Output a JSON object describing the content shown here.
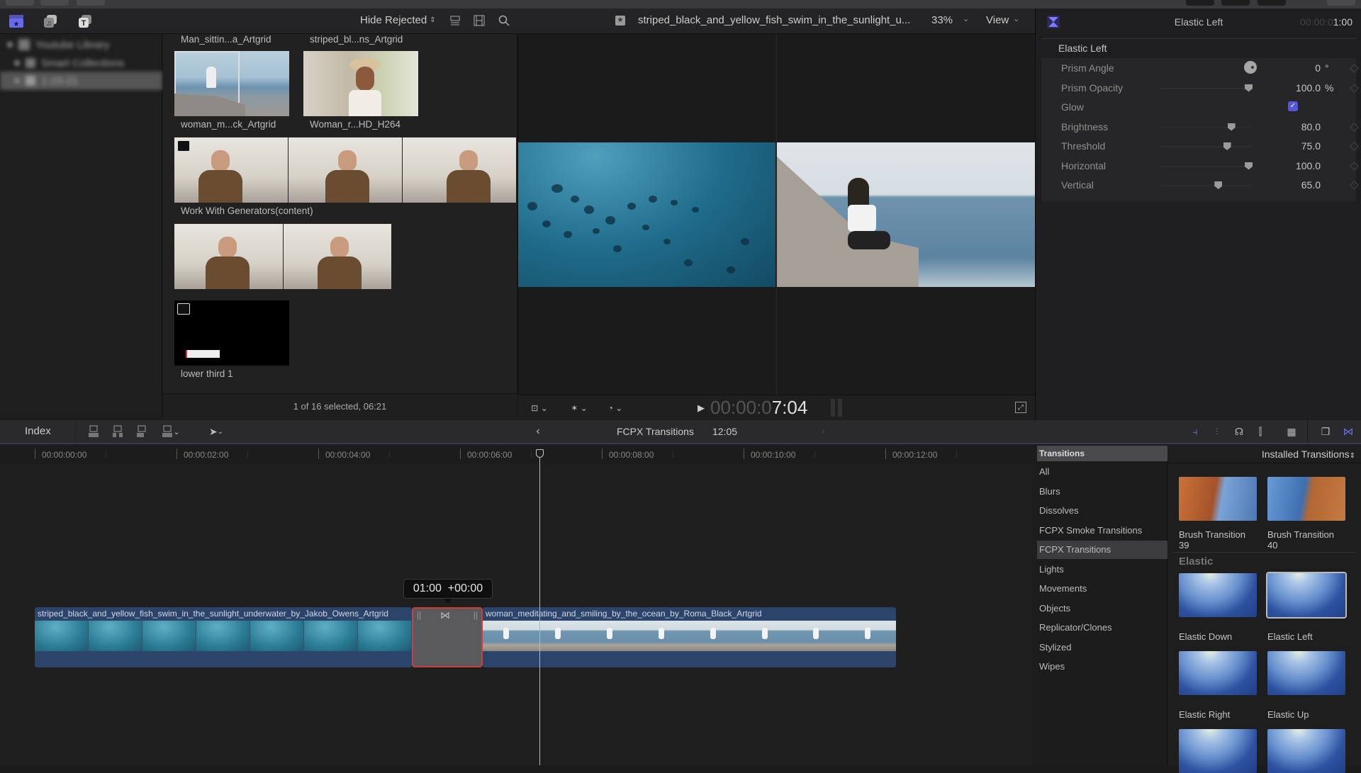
{
  "app": {
    "accent": "#5b5be0",
    "selection_outline": "#d0413a"
  },
  "library_sidebar": {
    "tabs": [
      {
        "icon": "libraries-icon",
        "active": true
      },
      {
        "icon": "photos-audio-icon",
        "active": false
      },
      {
        "icon": "titles-generators-icon",
        "active": false
      }
    ],
    "items": [
      {
        "label": "Youtube Library",
        "blurred": true
      },
      {
        "label": "Smart Collections",
        "blurred": true
      },
      {
        "label": "1-23-21",
        "blurred": true,
        "selected": true
      }
    ]
  },
  "browser": {
    "filter_label": "Hide Rejected",
    "icons": [
      "list-view-icon",
      "filmstrip-view-icon",
      "search-icon"
    ],
    "clips": [
      {
        "label": "Man_sittin...a_Artgrid"
      },
      {
        "label": "striped_bl...ns_Artgrid"
      },
      {
        "label": "woman_m...ck_Artgrid",
        "selected": true
      },
      {
        "label": "Woman_r...HD_H264"
      },
      {
        "label": "Work With Generators(content)"
      },
      {
        "label": ""
      },
      {
        "label": "lower third 1"
      }
    ],
    "status": "1 of 16 selected, 06:21"
  },
  "viewer": {
    "clip_name": "striped_black_and_yellow_fish_swim_in_the_sunlight_u...",
    "zoom": "33%",
    "view_label": "View",
    "timecode_dim": "00:00:0",
    "timecode_bright": "7:04"
  },
  "inspector": {
    "title": "Elastic Left",
    "duration_dim": "00:00:0",
    "duration_bright": "1:00",
    "section": "Elastic Left",
    "params": [
      {
        "label": "Prism Angle",
        "type": "dial",
        "value": "0",
        "unit": "°"
      },
      {
        "label": "Prism Opacity",
        "type": "slider",
        "value": "100.0",
        "unit": "%",
        "fraction": 1.0
      },
      {
        "label": "Glow",
        "type": "checkbox",
        "checked": true
      },
      {
        "label": "Brightness",
        "type": "slider",
        "value": "80.0",
        "unit": "",
        "fraction": 0.8
      },
      {
        "label": "Threshold",
        "type": "slider",
        "value": "75.0",
        "unit": "",
        "fraction": 0.75
      },
      {
        "label": "Horizontal",
        "type": "slider",
        "value": "100.0",
        "unit": "",
        "fraction": 1.0
      },
      {
        "label": "Vertical",
        "type": "slider",
        "value": "65.0",
        "unit": "",
        "fraction": 0.65
      }
    ]
  },
  "timeline": {
    "index_label": "Index",
    "project_name": "FCPX Transitions",
    "project_duration": "12:05",
    "ruler": [
      "00:00:00:00",
      "00:00:02:00",
      "00:00:04:00",
      "00:00:06:00",
      "00:00:08:00",
      "00:00:10:00",
      "00:00:12:00"
    ],
    "tooltip": "01:00  +00:00",
    "clips": [
      {
        "name": "striped_black_and_yellow_fish_swim_in_the_sunlight_underwater_by_Jakob_Owens_Artgrid",
        "kind": "fish"
      },
      {
        "name": "woman_meditating_and_smiling_by_the_ocean_by_Roma_Black_Artgrid",
        "kind": "woman"
      }
    ]
  },
  "transitions_browser": {
    "header": "Transitions",
    "installed_label": "Installed Transitions",
    "categories": [
      "All",
      "Blurs",
      "Dissolves",
      "FCPX Smoke Transitions",
      "FCPX Transitions",
      "Lights",
      "Movements",
      "Objects",
      "Replicator/Clones",
      "Stylized",
      "Wipes"
    ],
    "selected_category": "FCPX Transitions",
    "group_title": "Elastic",
    "items_above": [
      {
        "label": "Brush Transition\n39",
        "style": "brush-a"
      },
      {
        "label": "Brush Transition\n40",
        "style": "brush-b"
      }
    ],
    "items": [
      {
        "label": "Elastic Down",
        "selected": false
      },
      {
        "label": "Elastic Left",
        "selected": true
      },
      {
        "label": "Elastic Right",
        "selected": false
      },
      {
        "label": "Elastic Up",
        "selected": false
      },
      {
        "label": "",
        "selected": false
      },
      {
        "label": "",
        "selected": false
      }
    ]
  }
}
